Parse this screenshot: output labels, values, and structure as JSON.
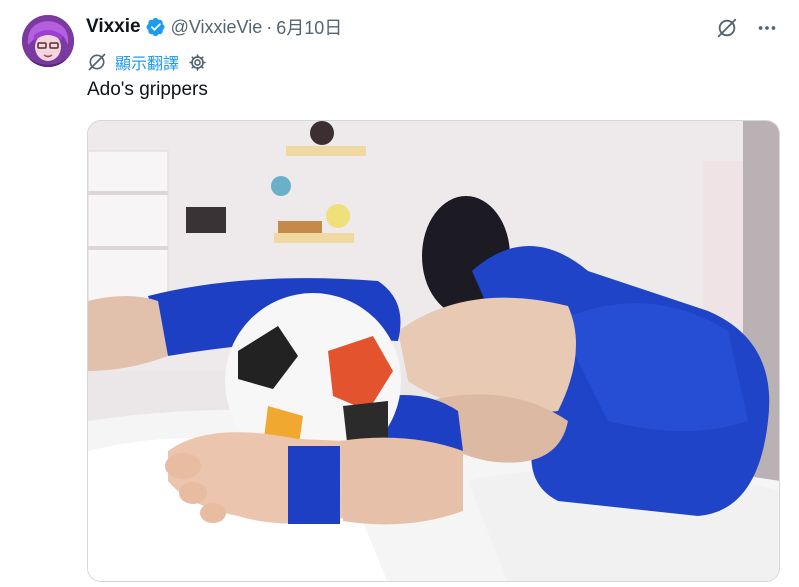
{
  "author": {
    "display_name": "Vixxie",
    "handle": "@VixxieVie",
    "separator": "·",
    "date": "6月10日",
    "verified": true,
    "avatar_icon": "avatar-image"
  },
  "translate": {
    "icon": "translate-icon",
    "link_label": "顯示翻譯",
    "settings_icon": "gear-icon"
  },
  "post": {
    "text": "Ado's grippers"
  },
  "top_actions": {
    "grok_icon": "grok-icon",
    "more_icon": "more-dots-icon"
  },
  "colors": {
    "accent": "#1d9bf0",
    "text_primary": "#0f1419",
    "text_secondary": "#536471",
    "border": "#cfd9de"
  },
  "media": {
    "type": "photo"
  }
}
